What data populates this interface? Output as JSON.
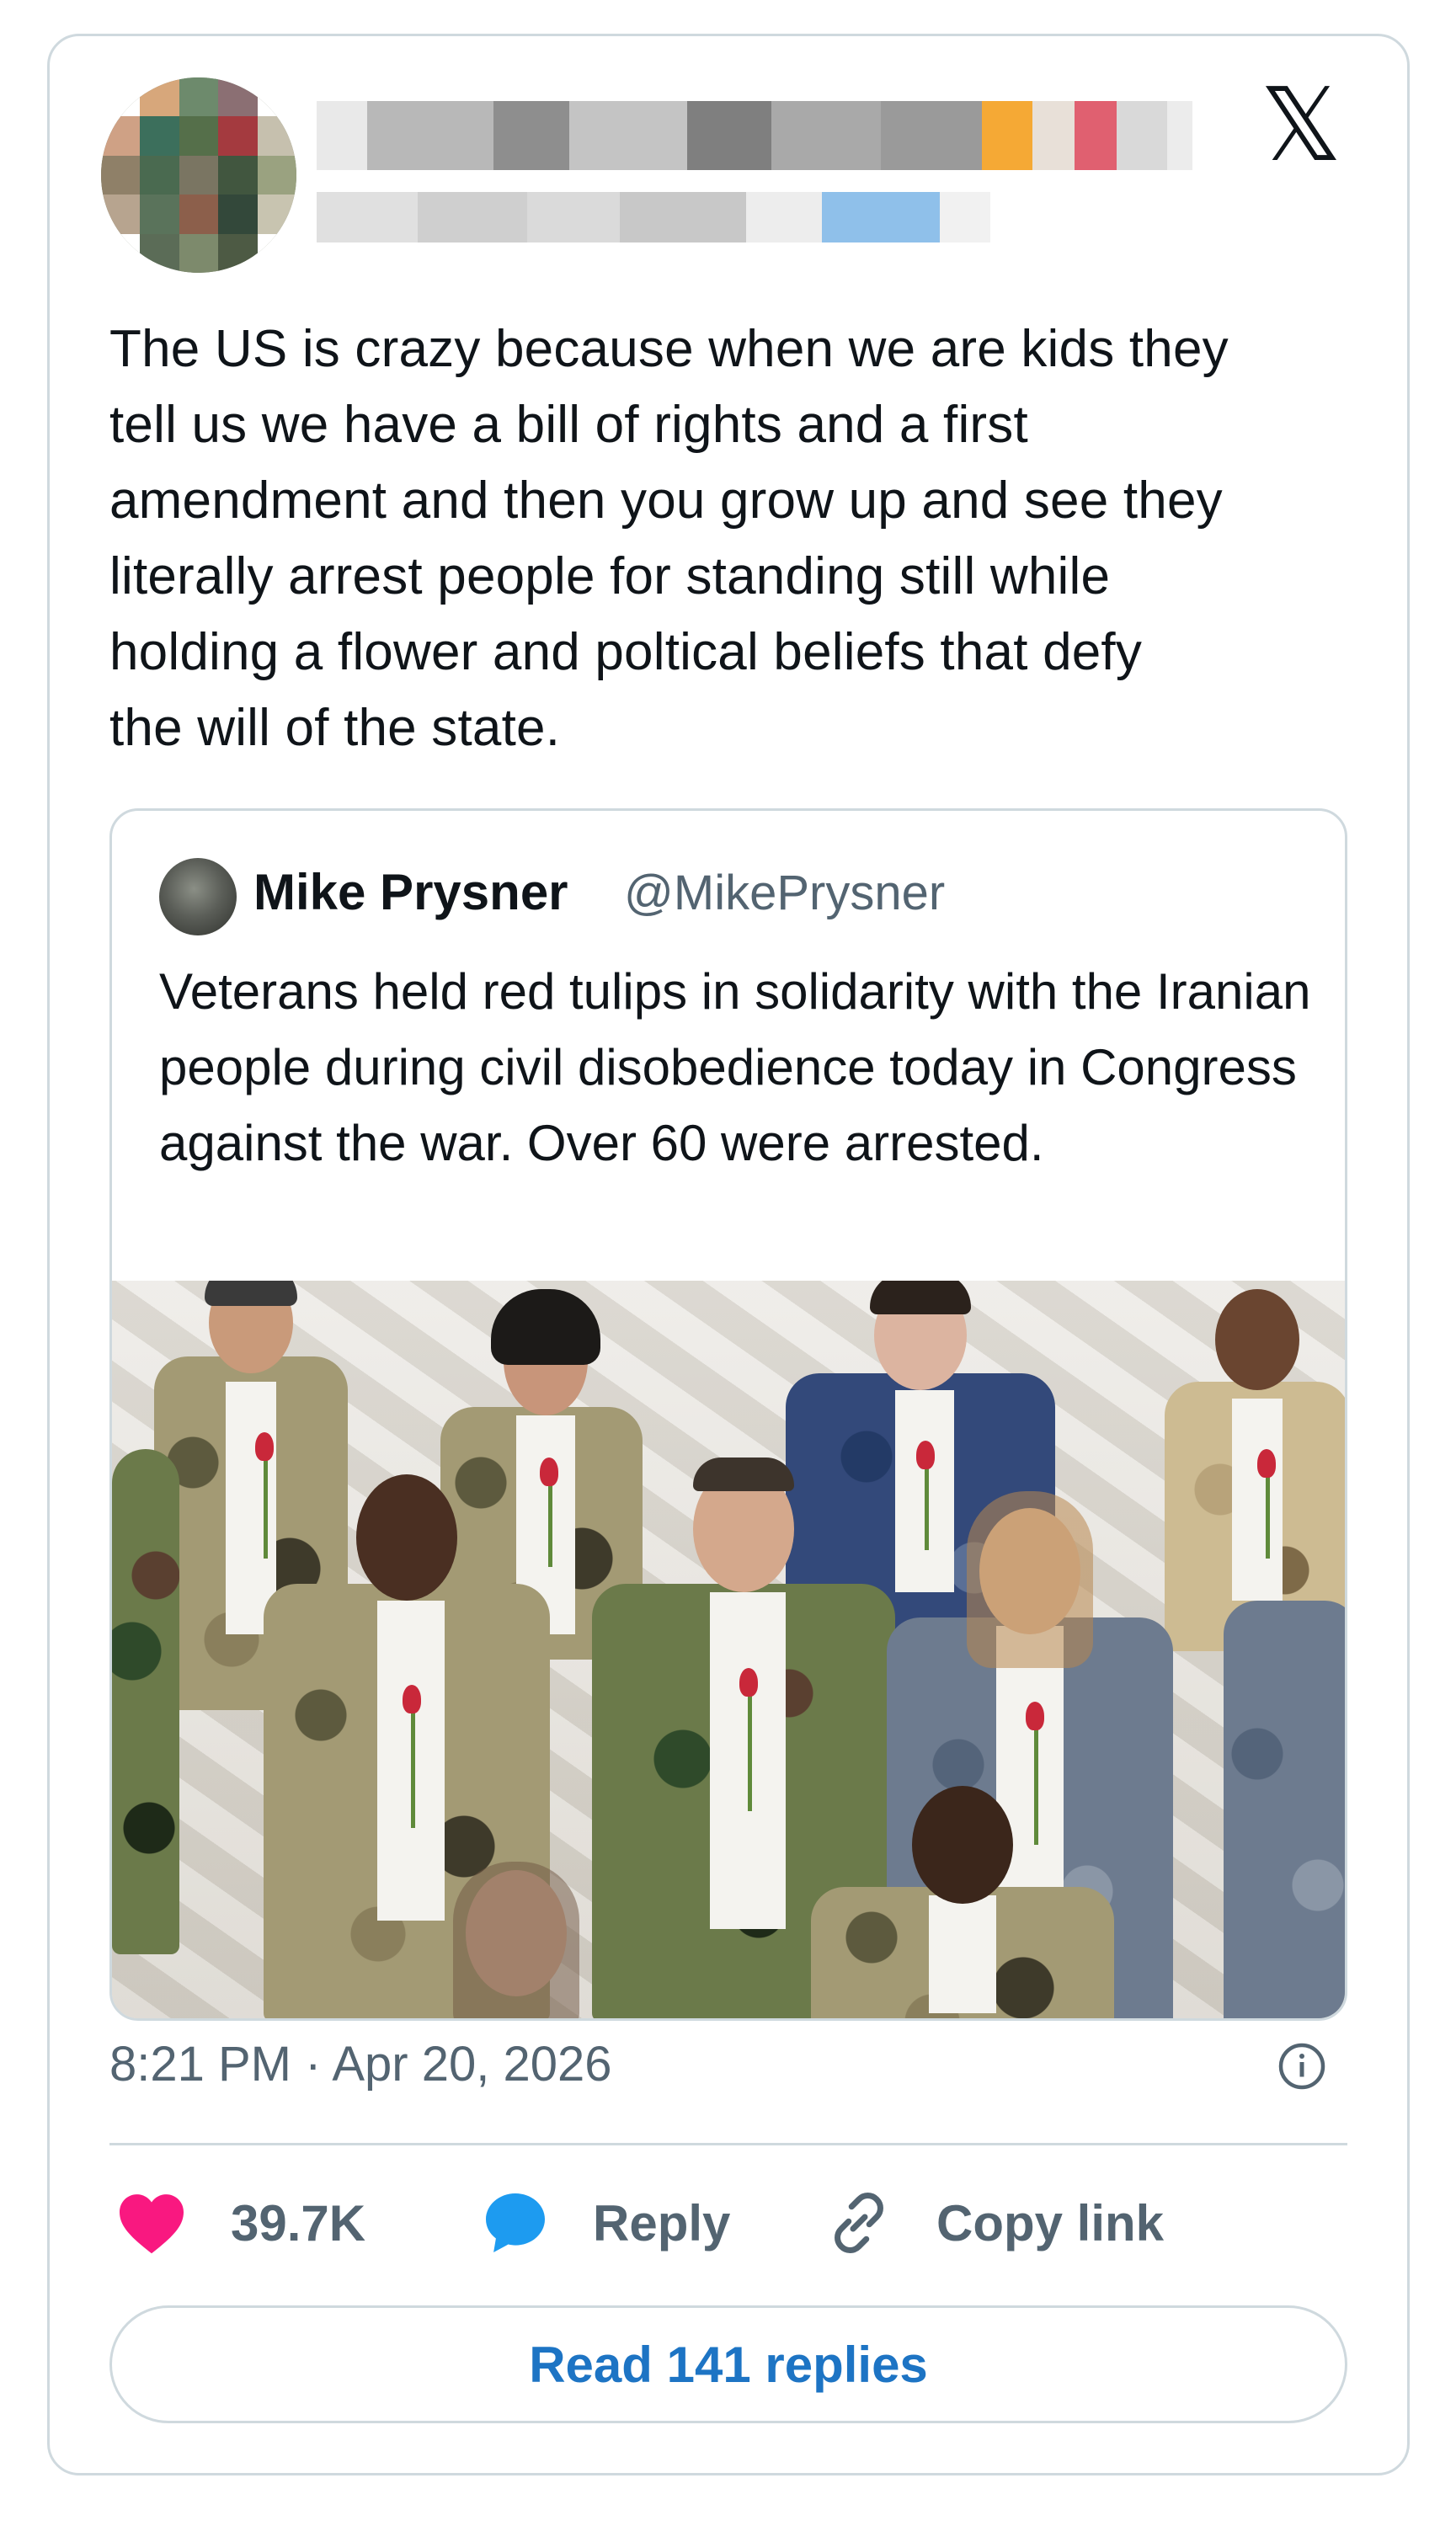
{
  "header": {
    "name_blurred": true,
    "handle_blurred": true,
    "logo_icon": "x-logo-icon",
    "logo_glyph": "𝕏"
  },
  "tweet": {
    "text": "The US is crazy because when we are kids they\ntell us we have a bill of rights and a first\namendment and then you grow up and see they\nliterally arrest people for standing still while\nholding a flower and poltical beliefs that defy\nthe will of the state."
  },
  "quote": {
    "name": "Mike Prysner",
    "handle": "@MikePrysner",
    "text": "Veterans held red tulips in solidarity with the Iranian people during civil disobedience today in Congress against the war.  Over 60 were arrested."
  },
  "footer": {
    "timestamp": "8:21 PM · Apr 20, 2026",
    "likes": "39.7K",
    "reply_label": "Reply",
    "copy_link_label": "Copy link",
    "read_replies_label": "Read 141 replies"
  },
  "colors": {
    "like_heart": "#f91880",
    "reply_bubble": "#1d9bf0",
    "link_blue": "#1d74c4",
    "muted_text": "#536471",
    "border": "#cfd9de"
  }
}
